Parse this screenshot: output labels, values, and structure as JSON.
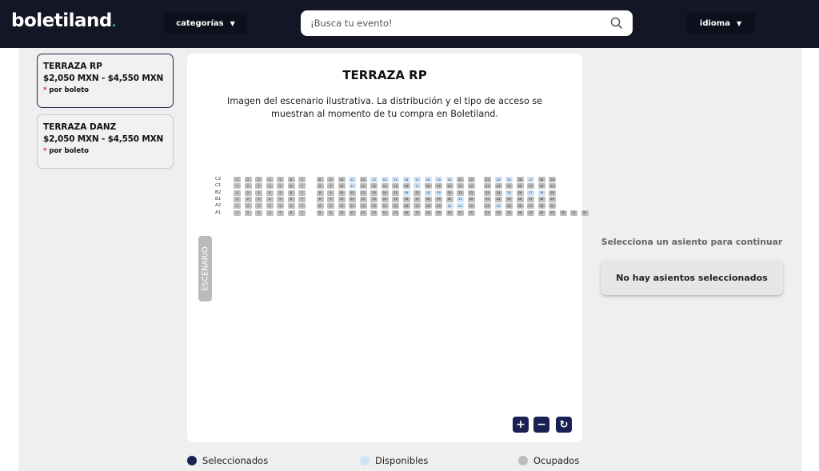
{
  "header": {
    "logo": "boletiland",
    "categories_label": "categorías",
    "search_placeholder": "¡Busca tu evento!",
    "language_label": "idioma"
  },
  "sections": [
    {
      "name": "TERRAZA RP",
      "price": "$2,050 MXN - $4,550 MXN",
      "note": "por boleto",
      "active": true
    },
    {
      "name": "TERRAZA DANZ",
      "price": "$2,050 MXN - $4,550 MXN",
      "note": "por boleto",
      "active": false
    }
  ],
  "map": {
    "title": "TERRAZA RP",
    "description": "Imagen del escenario ilustrativa. La distribución y el tipo de acceso se muestran al momento de tu compra en Boletiland.",
    "stage_label": "ESCENARIO",
    "rows": [
      {
        "label": "C2",
        "max": 29,
        "available": [
          11,
          13,
          14,
          15,
          16,
          17,
          18,
          19,
          20,
          24,
          25,
          27
        ]
      },
      {
        "label": "C1",
        "max": 29,
        "available": [
          11,
          17
        ]
      },
      {
        "label": "B2",
        "max": 29,
        "available": [
          16,
          18,
          19,
          25,
          27,
          28
        ]
      },
      {
        "label": "B1",
        "max": 29,
        "available": [
          21
        ]
      },
      {
        "label": "A2",
        "max": 29,
        "available": [
          20,
          21,
          24
        ]
      },
      {
        "label": "A1",
        "max": 32,
        "available": []
      }
    ],
    "controls": {
      "zoom_in": "+",
      "zoom_out": "−",
      "reset": "↻"
    }
  },
  "legend": {
    "selected": "Seleccionados",
    "selected_color": "#1a2051",
    "available": "Disponibles",
    "available_color": "#cfe3f7",
    "occupied": "Ocupados",
    "occupied_color": "#bdbdbd"
  },
  "sidebar": {
    "prompt": "Selecciona un asiento para continuar",
    "empty": "No hay asientos seleccionados"
  }
}
